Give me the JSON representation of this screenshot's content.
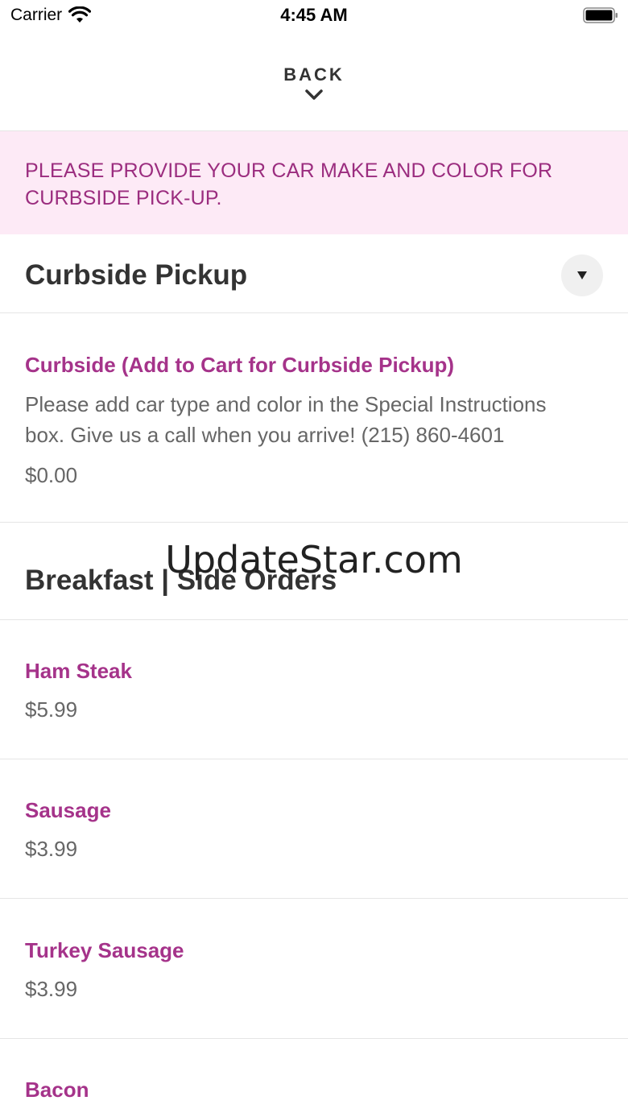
{
  "status_bar": {
    "carrier": "Carrier",
    "time": "4:45 AM"
  },
  "header": {
    "back_label": "BACK"
  },
  "notice": {
    "text": "PLEASE PROVIDE YOUR CAR MAKE AND COLOR FOR CURBSIDE PICK-UP."
  },
  "sections": [
    {
      "title": "Curbside Pickup",
      "items": [
        {
          "name": "Curbside (Add to Cart for Curbside Pickup)",
          "description": "Please add car type and color in the Special Instructions box. Give us a call when you arrive! (215) 860-4601",
          "price": "$0.00"
        }
      ]
    },
    {
      "title": "Breakfast | Side Orders",
      "items": [
        {
          "name": "Ham Steak",
          "price": "$5.99"
        },
        {
          "name": "Sausage",
          "price": "$3.99"
        },
        {
          "name": "Turkey Sausage",
          "price": "$3.99"
        },
        {
          "name": "Bacon"
        }
      ]
    }
  ],
  "watermark": "UpdateStar.com",
  "colors": {
    "accent": "#a5338a",
    "notice_bg": "#fdeaf6",
    "notice_text": "#9b2d7f"
  },
  "icons": [
    "wifi-icon",
    "battery-icon",
    "chevron-down-icon",
    "caret-down-icon"
  ]
}
